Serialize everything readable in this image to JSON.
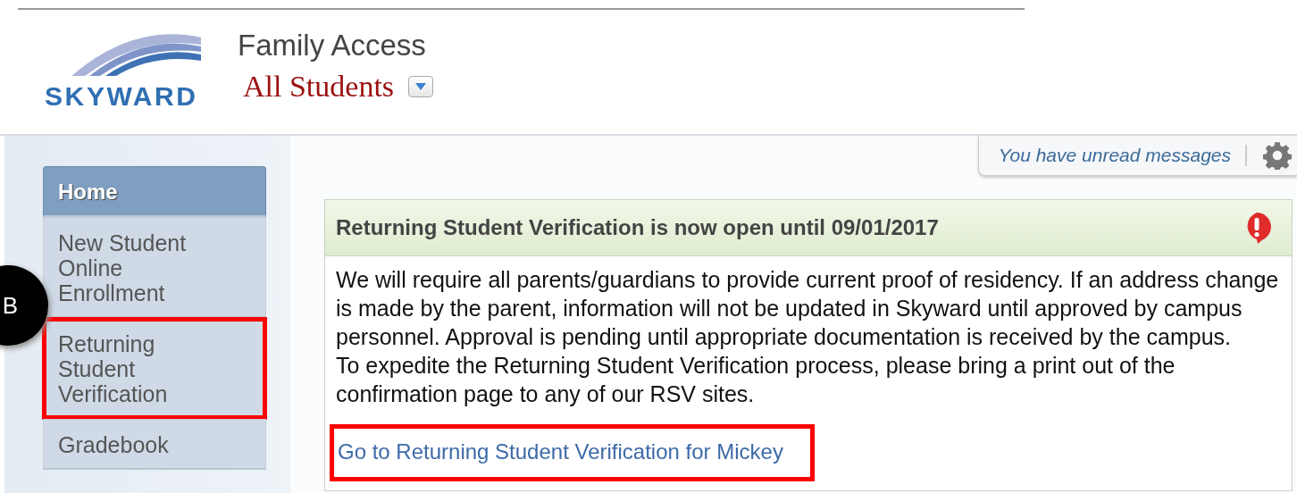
{
  "header": {
    "app_title": "Family Access",
    "student_selector": {
      "value": "All Students"
    },
    "logo_text": "SKYWARD"
  },
  "sidebar": {
    "items": [
      {
        "label": "Home",
        "selected": true,
        "highlighted": false
      },
      {
        "label": "New Student Online Enrollment",
        "selected": false,
        "highlighted": false
      },
      {
        "label": "Returning Student Verification",
        "selected": false,
        "highlighted": true
      },
      {
        "label": "Gradebook",
        "selected": false,
        "highlighted": false
      }
    ]
  },
  "callout": {
    "label": "B"
  },
  "messages_bar": {
    "text": "You have unread messages"
  },
  "notice": {
    "title": "Returning Student Verification is now open until 09/01/2017",
    "alert": true,
    "paragraphs": [
      "We will require all parents/guardians to provide current proof of residency. If an address change is made by the parent, information will not be updated in Skyward until approved by campus personnel. Approval is pending until appropriate documentation is received by the campus.",
      "To expedite the Returning Student Verification process, please bring a print out of the confirmation page to any of our RSV sites."
    ],
    "link": {
      "text": "Go to Returning Student Verification for Mickey",
      "highlighted": true
    }
  }
}
